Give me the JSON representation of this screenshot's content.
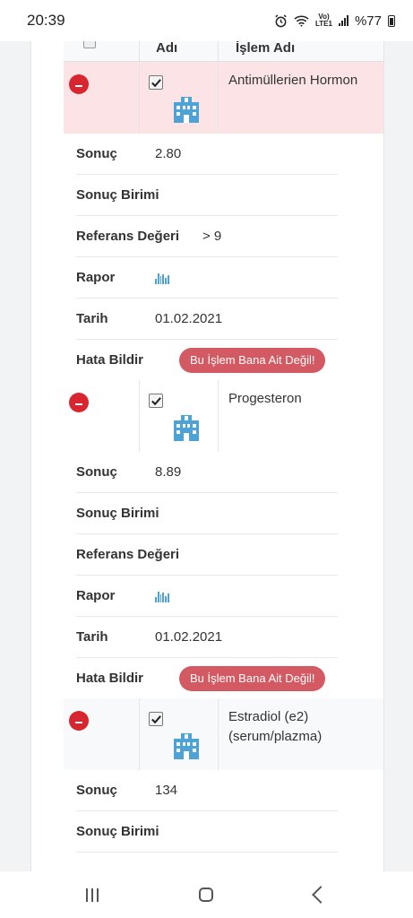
{
  "status_bar": {
    "time": "20:39",
    "volte": "Vo)\nLTE1",
    "battery": "%77"
  },
  "table": {
    "header": {
      "name": "Adı",
      "operation": "İşlem Adı"
    },
    "labels": {
      "result": "Sonuç",
      "unit": "Sonuç Birimi",
      "reference": "Referans Değeri",
      "report": "Rapor",
      "date": "Tarih",
      "report_error": "Hata Bildir"
    },
    "error_button": "Bu İşlem Bana Ait Değil!",
    "items": [
      {
        "operation": "Antimüllerien Hormon",
        "result": "2.80",
        "unit": "",
        "reference": "> 9",
        "date": "01.02.2021"
      },
      {
        "operation": "Progesteron",
        "result": "8.89",
        "unit": "",
        "reference": "",
        "date": "01.02.2021"
      },
      {
        "operation": "Estradiol (e2) (serum/plazma)",
        "result": "134",
        "unit": ""
      }
    ]
  },
  "colors": {
    "accent_red": "#d9252f",
    "button_red": "#d35a62",
    "highlight_pink": "#fce4e6",
    "icon_blue": "#4da3d6"
  }
}
